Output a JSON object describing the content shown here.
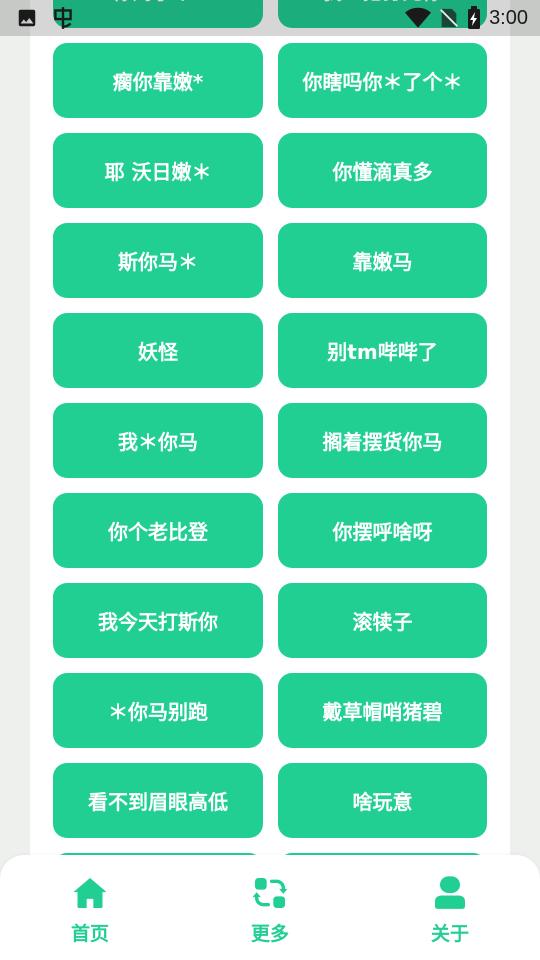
{
  "status_bar": {
    "time": "3:00",
    "icons": [
      "image-icon",
      "bug-icon",
      "wifi-icon",
      "no-sim-icon",
      "battery-charging-icon"
    ]
  },
  "buttons": [
    "你妈了个*",
    "我一把打死你",
    "瘸你靠嫩*",
    "你瞎吗你＊了个＊",
    "耶 沃日嫩＊",
    "你懂滴真多",
    "斯你马＊",
    "靠嫩马",
    "妖怪",
    "别tm哔哔了",
    "我＊你马",
    "搁着摆货你马",
    "你个老比登",
    "你摆呼啥呀",
    "我今天打斯你",
    "滚犊子",
    "＊你马别跑",
    "戴草帽哨猪碧",
    "看不到眉眼高低",
    "啥玩意",
    "",
    ""
  ],
  "nav": [
    {
      "label": "首页",
      "icon": "home-icon"
    },
    {
      "label": "更多",
      "icon": "refresh-icon"
    },
    {
      "label": "关于",
      "icon": "user-icon"
    }
  ],
  "colors": {
    "accent": "#21cf93",
    "background": "#eef0ee",
    "card": "#ffffff"
  }
}
